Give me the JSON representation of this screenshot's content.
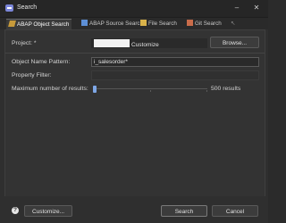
{
  "window": {
    "title": "Search",
    "minimize_glyph": "–",
    "close_glyph": "✕"
  },
  "tabs": [
    {
      "label": "ABAP Object Search",
      "icon": "abap-object-icon",
      "active": true
    },
    {
      "label": "ABAP Source Search",
      "icon": "abap-source-icon",
      "active": false
    },
    {
      "label": "File Search",
      "icon": "file-search-icon",
      "active": false
    },
    {
      "label": "Git Search",
      "icon": "git-search-icon",
      "active": false
    },
    {
      "label": "↖",
      "icon": "overflow-arrow-icon",
      "active": false
    }
  ],
  "form": {
    "project_label": "Project: *",
    "project_value": "Customize",
    "browse_label": "Browse...",
    "object_name_label": "Object Name Pattern:",
    "object_name_value": "i_salesorder*",
    "property_filter_label": "Property Filter:",
    "property_filter_value": "",
    "max_results_label": "Maximum number of results:",
    "max_results_text": "500 results",
    "max_results_value": 500
  },
  "footer": {
    "help_glyph": "?",
    "customize_label": "Customize...",
    "search_label": "Search",
    "cancel_label": "Cancel"
  },
  "colors": {
    "background": "#2f2f2f",
    "accent": "#7ea7e6"
  }
}
